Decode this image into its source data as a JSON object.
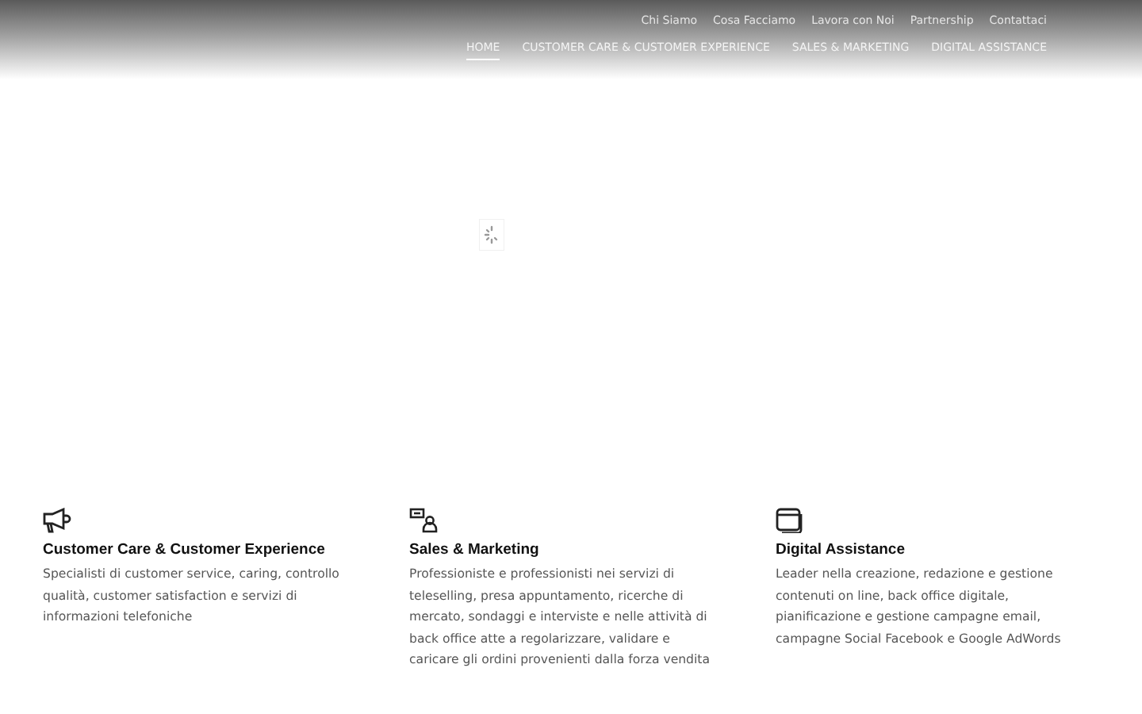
{
  "top_links": [
    "Chi Siamo",
    "Cosa Facciamo",
    "Lavora con Noi",
    "Partnership",
    "Contattaci"
  ],
  "nav": [
    {
      "label": "HOME",
      "selected": true
    },
    {
      "label": "CUSTOMER CARE & CUSTOMER EXPERIENCE",
      "selected": false
    },
    {
      "label": "SALES & MARKETING",
      "selected": false
    },
    {
      "label": "DIGITAL ASSISTANCE",
      "selected": false
    }
  ],
  "services": [
    {
      "kind": "megaphone",
      "title": "Customer Care & Customer Experience",
      "text": "Specialisti di customer service, caring, controllo qualità, customer satisfaction e servizi di informazioni telefoniche"
    },
    {
      "kind": "chat",
      "title": "Sales & Marketing",
      "text": "Professioniste e professionisti nei servizi di teleselling, presa appuntamento, ricerche di mercato, sondaggi e interviste e nelle attività di back office atte a regolarizzare, validare e caricare gli ordini provenienti dalla forza vendita"
    },
    {
      "kind": "window",
      "title": "Digital Assistance",
      "text": "Leader nella creazione, redazione e gestione contenuti on line, back office digitale, pianificazione e gestione campagne email, campagne Social Facebook e Google AdWords"
    }
  ]
}
